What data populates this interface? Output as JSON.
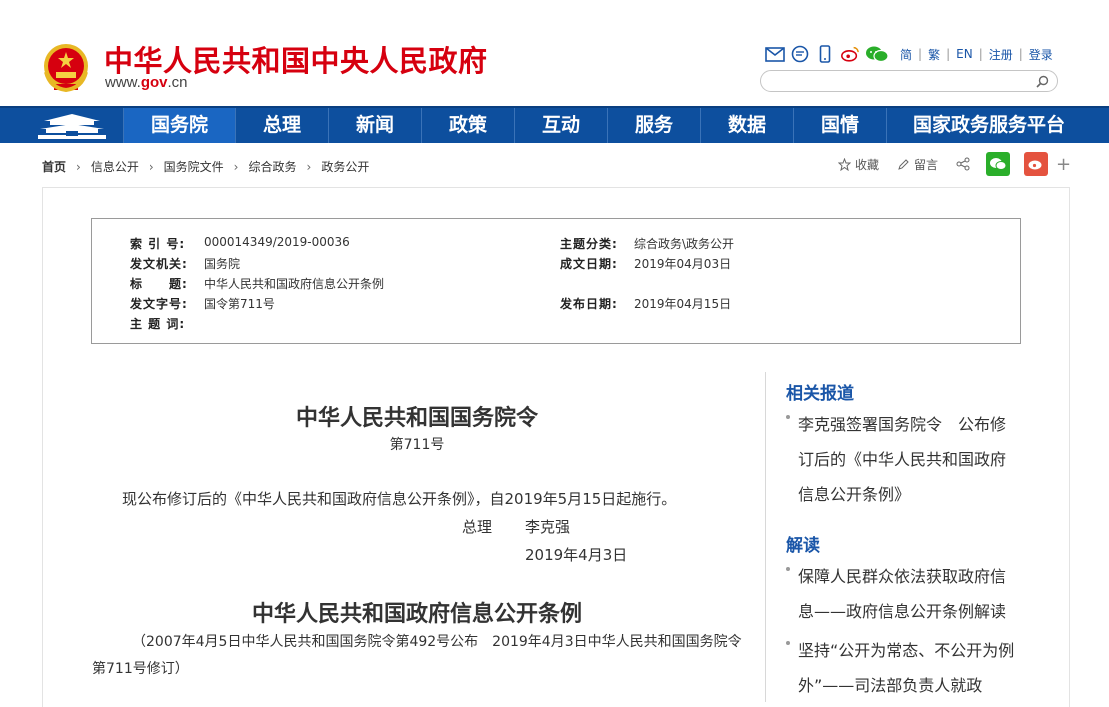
{
  "header": {
    "site_title": "中华人民共和国中央人民政府",
    "url_prefix": "www.",
    "url_red": "gov",
    "url_suffix": ".cn",
    "links": [
      "简",
      "繁",
      "EN",
      "注册",
      "登录"
    ],
    "search_placeholder": ""
  },
  "nav": {
    "items": [
      "国务院",
      "总理",
      "新闻",
      "政策",
      "互动",
      "服务",
      "数据",
      "国情",
      "国家政务服务平台"
    ]
  },
  "breadcrumb": [
    "首页",
    "信息公开",
    "国务院文件",
    "综合政务",
    "政务公开"
  ],
  "share": {
    "favorite": "收藏",
    "comment": "留言"
  },
  "info": {
    "index_key": "索 引 号:",
    "index_val": "000014349/2019-00036",
    "topic_key": "主题分类:",
    "topic_val": "综合政务\\政务公开",
    "issuer_key": "发文机关:",
    "issuer_val": "国务院",
    "date_key": "成文日期:",
    "date_val": "2019年04月03日",
    "title_key": "标　　题:",
    "title_val": "中华人民共和国政府信息公开条例",
    "docno_key": "发文字号:",
    "docno_val": "国令第711号",
    "pub_key": "发布日期:",
    "pub_val": "2019年04月15日",
    "subject_key": "主 题 词:"
  },
  "article": {
    "title1": "中华人民共和国国务院令",
    "number": "第711号",
    "line1": "现公布修订后的《中华人民共和国政府信息公开条例》，自2019年5月15日起施行。",
    "sign_role": "总理",
    "sign_name": "李克强",
    "sign_date": "2019年4月3日",
    "title2": "中华人民共和国政府信息公开条例",
    "note": "（2007年4月5日中华人民共和国国务院令第492号公布　2019年4月3日中华人民共和国国务院令第711号修订）"
  },
  "sidebar": {
    "related_title": "相关报道",
    "related_items": [
      "李克强签署国务院令　公布修订后的《中华人民共和国政府信息公开条例》"
    ],
    "interpret_title": "解读",
    "interpret_items": [
      "保障人民群众依法获取政府信息——政府信息公开条例解读",
      "坚持“公开为常态、不公开为例外”——司法部负责人就政"
    ]
  },
  "colors": {
    "brand_red": "#d6000f",
    "nav_blue": "#0d4f9e",
    "nav_active": "#1a66c2",
    "link_blue": "#1a56a8"
  }
}
